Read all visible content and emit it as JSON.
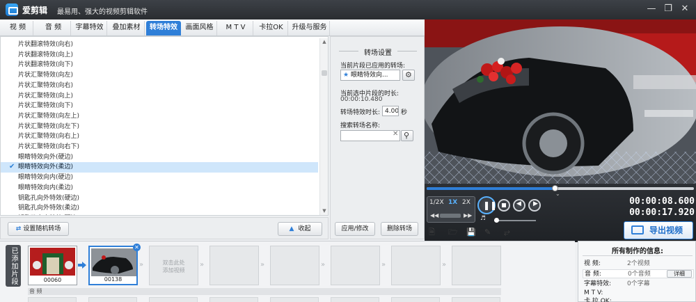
{
  "app": {
    "title": "爱剪辑",
    "slogan": "最易用、强大的视频剪辑软件",
    "brand_color": "#2f7fd8"
  },
  "tabs": [
    {
      "label": "视  频"
    },
    {
      "label": "音  频"
    },
    {
      "label": "字幕特效"
    },
    {
      "label": "叠加素材"
    },
    {
      "label": "转场特效",
      "active": true
    },
    {
      "label": "画面风格"
    },
    {
      "label": "M T V"
    },
    {
      "label": "卡拉OK"
    },
    {
      "label": "升级与服务"
    }
  ],
  "transition_list": {
    "items": [
      "片状翻滚特效(向右)",
      "片状翻滚特效(向上)",
      "片状翻滚特效(向下)",
      "片状汇聚特效(向左)",
      "片状汇聚特效(向右)",
      "片状汇聚特效(向上)",
      "片状汇聚特效(向下)",
      "片状汇聚特效(向左上)",
      "片状汇聚特效(向左下)",
      "片状汇聚特效(向右上)",
      "片状汇聚特效(向右下)",
      "眼睛特效向外(硬边)",
      "眼睛特效向外(柔边)",
      "眼睛特效向内(硬边)",
      "眼睛特效向内(柔边)",
      "钥匙孔向外特效(硬边)",
      "钥匙孔向外特效(柔边)",
      "钥匙孔向内特效(硬边)"
    ],
    "selected_index": 12,
    "random_button": "设置随机转场",
    "collapse_button": "收起"
  },
  "settings": {
    "title": "转场设置",
    "applied_label": "当前片段已应用的转场:",
    "applied_value": "眼睛特效向...",
    "duration_label": "当前选中片段的时长:",
    "duration_value": "00:00:10.480",
    "effect_duration_label": "转场特效时长:",
    "effect_duration_value": "4.00",
    "effect_duration_unit": "秒",
    "search_label": "搜索转场名称:",
    "search_value": "",
    "apply_button": "应用/修改",
    "delete_button": "删除转场"
  },
  "player": {
    "speeds": [
      "1/2X",
      "1X",
      "2X"
    ],
    "active_speed": "1X",
    "current_time": "00:00:08.600",
    "total_time": "00:00:17.920",
    "progress": 0.48,
    "export_button": "导出视频",
    "toolbar_icons": [
      "new-file-icon",
      "open-folder-icon",
      "save-icon",
      "save-as-icon",
      "share-icon"
    ]
  },
  "timeline": {
    "side_label": "已添加片段",
    "clips": [
      {
        "name": "00060",
        "filled": true
      },
      {
        "name": "00138",
        "filled": true,
        "selected": true
      }
    ],
    "placeholder_hint": "双击此处\n添加视频",
    "audio_label": "音 频"
  },
  "info": {
    "title": "所有制作的信息:",
    "rows": [
      {
        "key": "视    频:",
        "value": "2个视频"
      },
      {
        "key": "音    频:",
        "value": "0个音频",
        "detail": "详细"
      },
      {
        "key": "字幕特效:",
        "value": "0个字幕"
      },
      {
        "key": "M  T  V:",
        "value": ""
      },
      {
        "key": "卡 拉 OK:",
        "value": ""
      }
    ]
  }
}
